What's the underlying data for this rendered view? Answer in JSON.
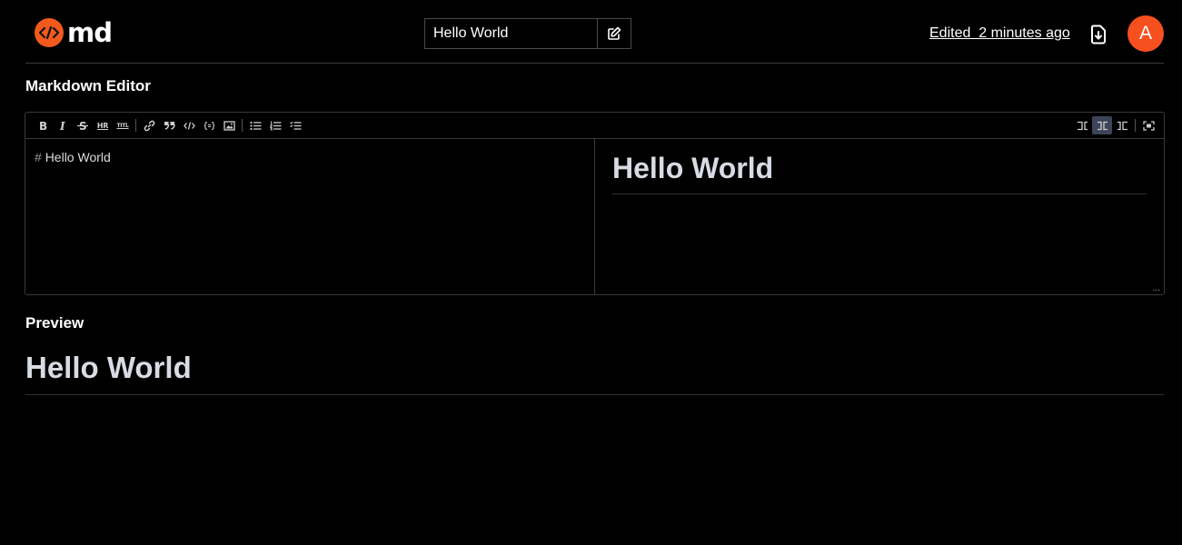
{
  "app": {
    "logo_text": "md",
    "brand_color": "#f25a1d"
  },
  "header": {
    "doc_title_value": "Hello World",
    "edited_text": "Edited  2 minutes ago",
    "avatar_letter": "A",
    "avatar_color": "#f5501e"
  },
  "sections": {
    "editor_title": "Markdown Editor",
    "preview_title": "Preview"
  },
  "toolbar": {
    "left_items": [
      "bold-icon",
      "italic-icon",
      "strikethrough-icon",
      "hr-icon",
      "title-icon",
      "link-icon",
      "quote-icon",
      "code-icon",
      "code-block-icon",
      "image-icon",
      "unordered-list-icon",
      "ordered-list-icon",
      "checked-list-icon"
    ],
    "hr_label": "HR",
    "title_label": "TITL",
    "right_items": [
      "edit-only-icon",
      "live-view-icon",
      "preview-only-icon",
      "fullscreen-icon"
    ],
    "active_item": "live-view-icon",
    "active_color": "#3c4558"
  },
  "editor": {
    "hash": "#",
    "source_text": "Hello World",
    "live_heading": "Hello World",
    "resize_glyph": "..."
  },
  "preview": {
    "heading": "Hello World"
  }
}
